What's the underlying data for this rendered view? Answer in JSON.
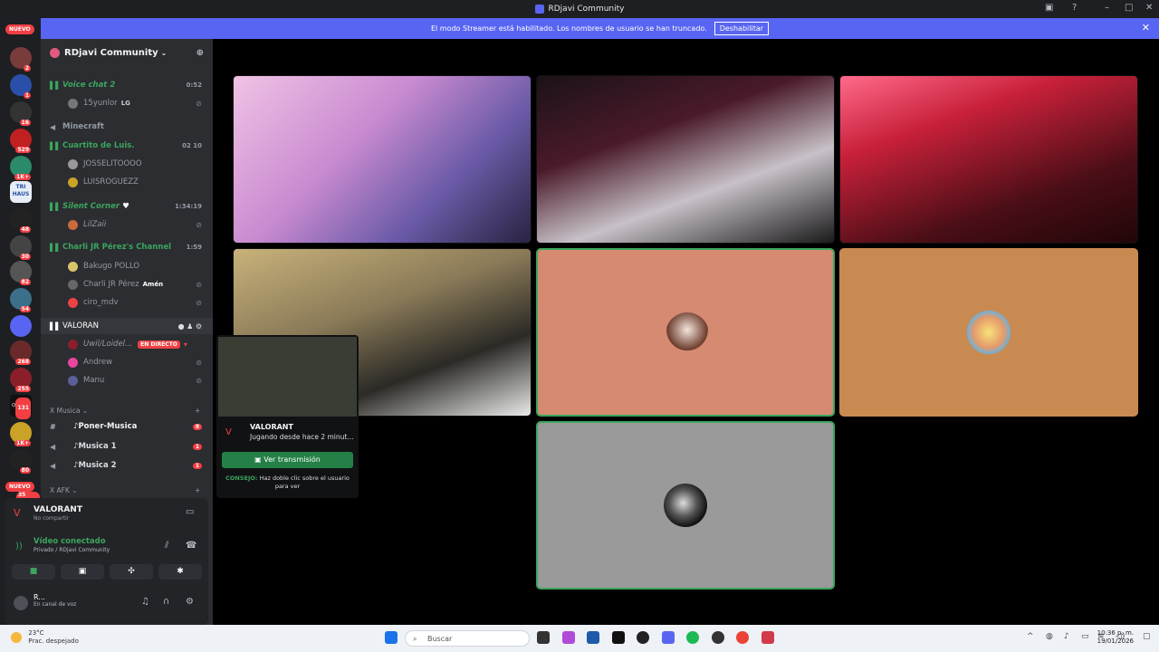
{
  "window": {
    "title": "RDjavi Community"
  },
  "streamer_banner": {
    "text": "El modo Streamer está habilitado. Los nombres de usuario se han truncado.",
    "button": "Deshabilitar"
  },
  "rail": {
    "nuevo_top": "NUEVO",
    "nuevo_bottom": "NUEVO",
    "badges": [
      "2",
      "1",
      "16",
      "529",
      "1K+",
      "48",
      "30",
      "82",
      "54",
      "268",
      "255",
      "131",
      "1K+",
      "80",
      "35"
    ],
    "text_icon": "TRI HAUS",
    "origen_label": "ORIGEN"
  },
  "sidebar": {
    "server_name": "RDjavi Community",
    "rows": [
      {
        "name": "Voice chat 2",
        "type": "voice",
        "right": "0:52"
      },
      {
        "name": "15yunlor",
        "type": "user",
        "tag": "LG"
      },
      {
        "name": "Minecraft",
        "type": "voice-muted"
      },
      {
        "name": "Cuartito de Luis.",
        "type": "voice",
        "right": "02 10"
      },
      {
        "name": "JOSSELITOOOO",
        "type": "user"
      },
      {
        "name": "LUISROGUEZZ",
        "type": "user"
      },
      {
        "name": "Silent Corner",
        "type": "voice",
        "right": "1:34:19"
      },
      {
        "name": "LilZaii",
        "type": "user"
      },
      {
        "name": "Charli JR Pérez's Channel",
        "type": "voice",
        "right": "1:59"
      },
      {
        "name": "Bakugo POLLO",
        "type": "user"
      },
      {
        "name": "Charli JR Pérez",
        "type": "user",
        "tag": "Amén"
      },
      {
        "name": "ciro_mdv",
        "type": "user"
      },
      {
        "name": "VALORAN",
        "type": "voice-active"
      },
      {
        "name": "Uwil/Loidel...",
        "type": "user",
        "live": "EN DIRECTO"
      },
      {
        "name": "Andrew",
        "type": "user"
      },
      {
        "name": "Manu",
        "type": "user"
      }
    ],
    "category_musica": "X Musica",
    "musica_rows": [
      {
        "name": "Poner-Musica",
        "count": "8"
      },
      {
        "name": "Musica 1",
        "count": "1"
      },
      {
        "name": "Musica 2",
        "count": "1"
      }
    ],
    "category_afk": "X AFK"
  },
  "panel": {
    "game": "VALORANT",
    "game_sub": "No compartir",
    "voice_status": "Vídeo conectado",
    "voice_sub": "Privado / RDjavi Community",
    "user_name": "R...",
    "user_status": "En canal de voz"
  },
  "popup": {
    "game": "VALORANT",
    "activity": "Jugando desde hace 2 minut...",
    "watch_button": "Ver transmisión",
    "tip_label": "CONSEJO:",
    "tip_text": "Haz doble clic sobre el usuario para ver"
  },
  "taskbar": {
    "temp": "23°C",
    "weather": "Prac. despejado",
    "search": "Buscar",
    "time": "10:36 p. m.",
    "date": "19/01/2026"
  },
  "colors": {
    "blurple": "#5865f2",
    "green": "#3ba55d",
    "red": "#f23f43",
    "tile_salmon": "#d68a72",
    "tile_tan": "#c98a52",
    "tile_gray": "#9a9a9a"
  }
}
